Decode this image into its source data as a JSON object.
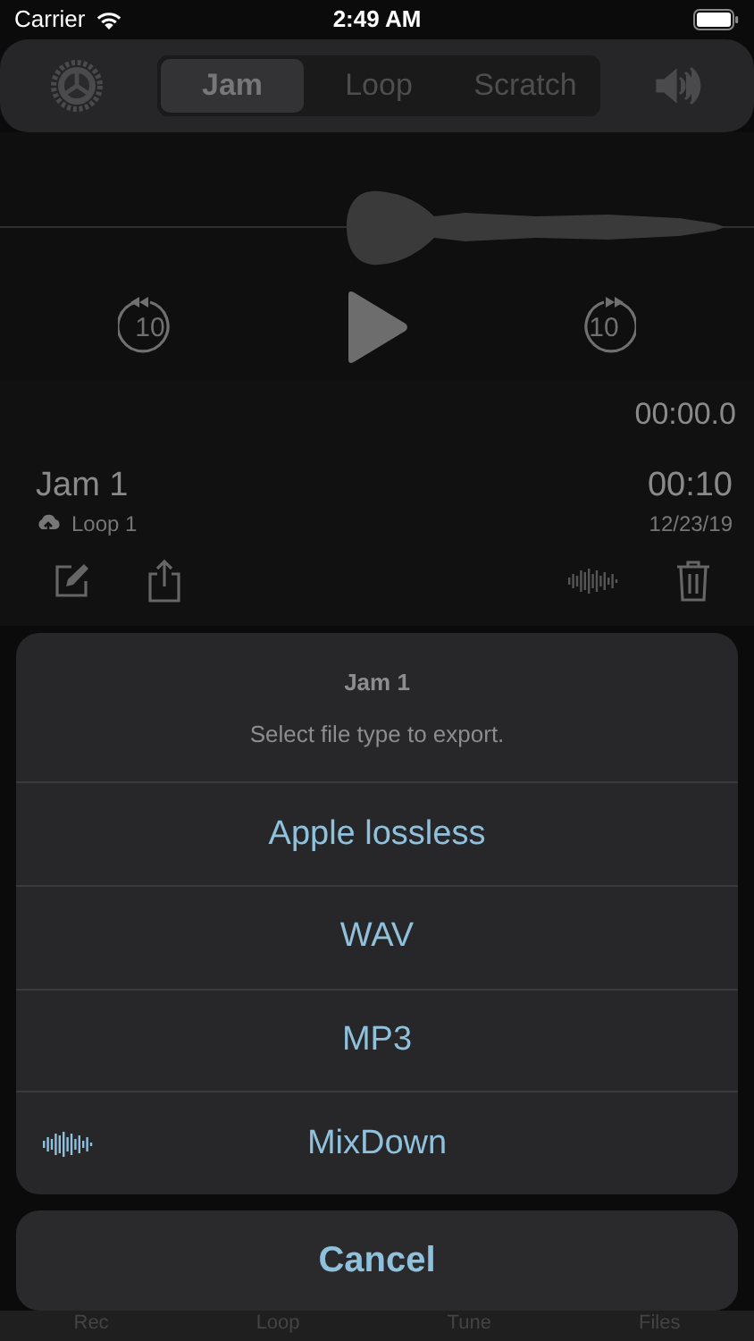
{
  "status_bar": {
    "carrier": "Carrier",
    "time": "2:49 AM"
  },
  "segments": [
    {
      "label": "Jam",
      "selected": true
    },
    {
      "label": "Loop",
      "selected": false
    },
    {
      "label": "Scratch",
      "selected": false
    }
  ],
  "transport": {
    "skip_back": "10",
    "skip_forward": "10"
  },
  "elapsed": "00:00.0",
  "recording": {
    "title": "Jam 1",
    "source": "Loop 1",
    "duration": "00:10",
    "date": "12/23/19"
  },
  "export_sheet": {
    "title": "Jam 1",
    "message": "Select file type to export.",
    "options": [
      {
        "label": "Apple lossless",
        "kind": "plain"
      },
      {
        "label": "WAV",
        "kind": "plain"
      },
      {
        "label": "MP3",
        "kind": "plain"
      },
      {
        "label": "MixDown",
        "kind": "mixdown"
      }
    ],
    "cancel": "Cancel"
  },
  "tab_bar": [
    "Rec",
    "Loop",
    "Tune",
    "Files"
  ]
}
